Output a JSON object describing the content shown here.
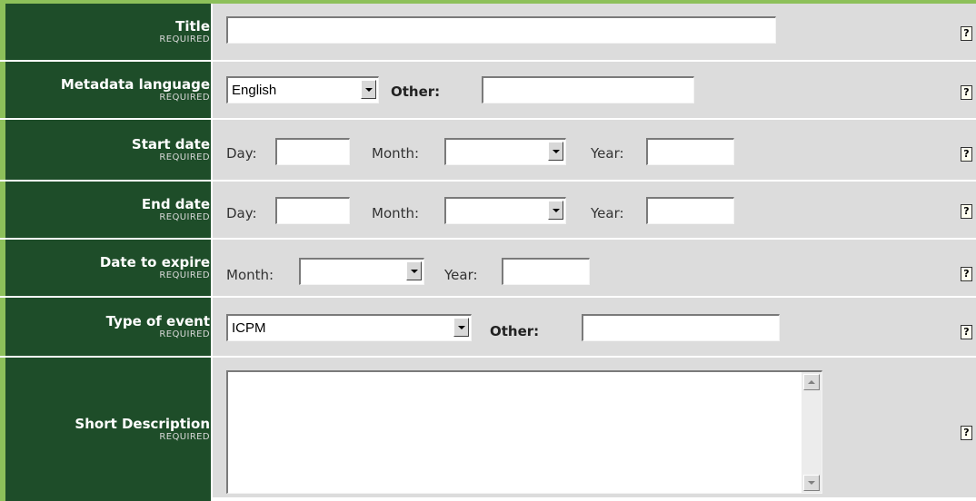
{
  "colors": {
    "label_bg": "#1e4d29",
    "accent_border": "#8dc05a",
    "field_bg": "#dcdcdc"
  },
  "help_icon": {
    "icon": "help-icon",
    "glyph": "?"
  },
  "required_text": "REQUIRED",
  "rows": {
    "title": {
      "label": "Title",
      "value": ""
    },
    "metadata_language": {
      "label": "Metadata language",
      "selected": "English",
      "other_label": "Other:",
      "other_value": ""
    },
    "start_date": {
      "label": "Start date",
      "day_label": "Day:",
      "day_value": "",
      "month_label": "Month:",
      "month_selected": "",
      "year_label": "Year:",
      "year_value": ""
    },
    "end_date": {
      "label": "End date",
      "day_label": "Day:",
      "day_value": "",
      "month_label": "Month:",
      "month_selected": "",
      "year_label": "Year:",
      "year_value": ""
    },
    "date_to_expire": {
      "label": "Date to expire",
      "month_label": "Month:",
      "month_selected": "",
      "year_label": "Year:",
      "year_value": ""
    },
    "type_of_event": {
      "label": "Type of event",
      "selected": "ICPM",
      "other_label": "Other:",
      "other_value": ""
    },
    "short_description": {
      "label": "Short Description",
      "value": ""
    }
  }
}
